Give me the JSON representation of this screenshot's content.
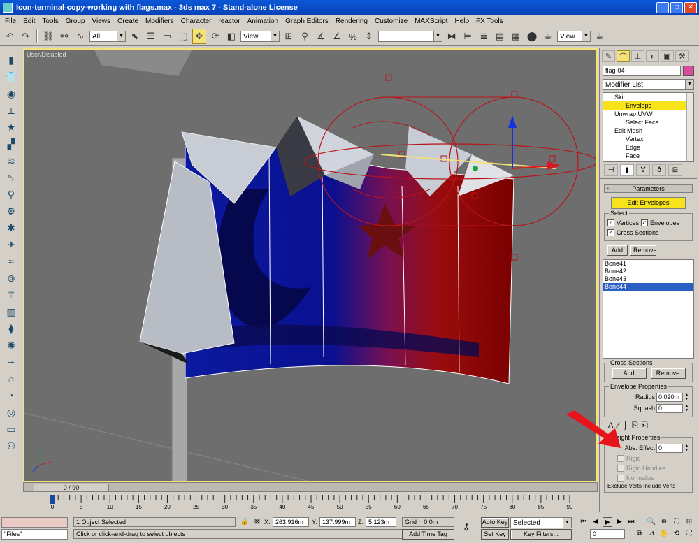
{
  "window": {
    "title": "Icon-terminal-copy-working with flags.max - 3ds max 7 - Stand-alone License",
    "minimize": "_",
    "maximize": "□",
    "close": "✕"
  },
  "menu": [
    "File",
    "Edit",
    "Tools",
    "Group",
    "Views",
    "Create",
    "Modifiers",
    "Character",
    "reactor",
    "Animation",
    "Graph Editors",
    "Rendering",
    "Customize",
    "MAXScript",
    "Help",
    "FX Tools"
  ],
  "toolbar": {
    "selection_filter": "All",
    "ref_coord": "View",
    "named_selection": "",
    "render_type": "View"
  },
  "viewport": {
    "label": "User/Disabled"
  },
  "timeslider": {
    "frame_label": "0 / 90"
  },
  "trackbar": {
    "ticks": [
      "0",
      "5",
      "10",
      "15",
      "20",
      "25",
      "30",
      "35",
      "40",
      "45",
      "50",
      "55",
      "60",
      "65",
      "70",
      "75",
      "80",
      "85",
      "90"
    ]
  },
  "command_panel": {
    "object_name": "flag-04",
    "modifier_list": "Modifier List",
    "stack": [
      {
        "label": "Skin",
        "level": 0,
        "selected": false
      },
      {
        "label": "Envelope",
        "level": 1,
        "selected": true
      },
      {
        "label": "Unwrap UVW",
        "level": 0,
        "selected": false
      },
      {
        "label": "Select Face",
        "level": 1,
        "selected": false
      },
      {
        "label": "Edit Mesh",
        "level": 0,
        "selected": false
      },
      {
        "label": "Vertex",
        "level": 1,
        "selected": false
      },
      {
        "label": "Edge",
        "level": 1,
        "selected": false
      },
      {
        "label": "Face",
        "level": 1,
        "selected": false
      }
    ],
    "parameters_title": "Parameters",
    "edit_envelopes": "Edit Envelopes",
    "select_group": "Select",
    "vertices": "Vertices",
    "envelopes": "Envelopes",
    "cross_sections": "Cross Sections",
    "add": "Add",
    "remove": "Remove",
    "bones": [
      {
        "name": "Bone41",
        "selected": false
      },
      {
        "name": "Bone42",
        "selected": false
      },
      {
        "name": "Bone43",
        "selected": false
      },
      {
        "name": "Bone44",
        "selected": true
      }
    ],
    "cross_sections_group": "Cross Sections",
    "cs_add": "Add",
    "cs_remove": "Remove",
    "envelope_properties": "Envelope Properties",
    "radius_label": "Radius",
    "radius_value": "0.020m",
    "squash_label": "Squash",
    "squash_value": "0",
    "weight_properties": "Weight Properties",
    "abs_effect_label": "Abs. Effect",
    "abs_effect_value": "0",
    "rigid": "Rigid",
    "rigid_handles": "Rigid Handles",
    "normalize": "Normalize",
    "bottom_cut": "Exclude Verts  Include Verts"
  },
  "status": {
    "objects_selected": "1 Object Selected",
    "prompt": "Click or click-and-drag to select objects",
    "x_label": "X:",
    "x_value": "263.916m",
    "y_label": "Y:",
    "y_value": "137.999m",
    "z_label": "Z:",
    "z_value": "5.123m",
    "grid": "Grid = 0.0m",
    "add_time_tag": "Add Time Tag",
    "auto_key": "Auto Key",
    "set_key": "Set Key",
    "key_mode": "Selected",
    "key_filters": "Key Filters...",
    "frame": "0",
    "listener": "\"Files\""
  }
}
